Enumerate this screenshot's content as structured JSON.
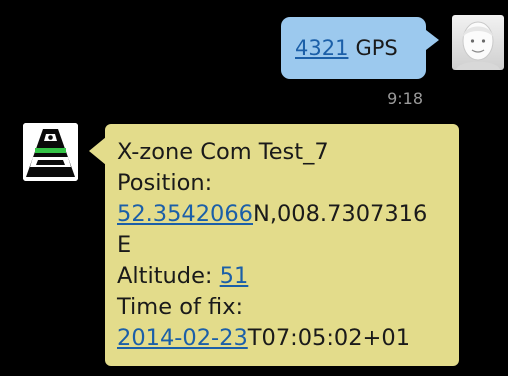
{
  "conversation": {
    "outgoing": {
      "code": "4321",
      "keyword": "GPS",
      "time": "9:18",
      "avatar_icon": "user-avatar-icon"
    },
    "incoming": {
      "sender_icon": "xzone-device-icon",
      "title": "X-zone Com Test_7",
      "position_label": "Position:",
      "latitude": "52.3542066",
      "lat_suffix": "N,008.7307316",
      "lon_suffix": "E",
      "altitude_label": "Altitude:",
      "altitude_value": "51",
      "fix_label": "Time of fix:",
      "fix_date": "2014-02-23",
      "fix_time": "T07:05:02+01"
    }
  },
  "colors": {
    "background": "#000000",
    "outgoing_bubble": "#9cc9ee",
    "incoming_bubble": "#e3dc8b",
    "link": "#1b5fa8",
    "timestamp": "#9a9a9a"
  }
}
